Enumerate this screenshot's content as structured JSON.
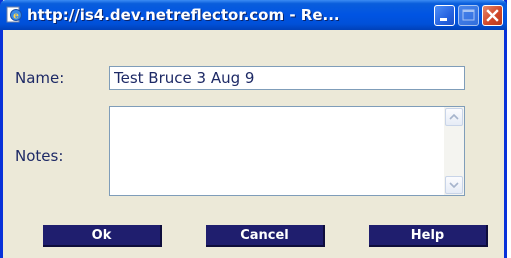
{
  "window": {
    "title": "http://is4.dev.netreflector.com - Re...",
    "controls": {
      "minimize_icon": "minimize-icon",
      "maximize_icon": "maximize-icon",
      "close_icon": "close-icon"
    },
    "title_icon": "ie-page-icon"
  },
  "form": {
    "name_label": "Name:",
    "name_value": "Test Bruce 3 Aug 9",
    "notes_label": "Notes:",
    "notes_value": ""
  },
  "buttons": {
    "ok": "Ok",
    "cancel": "Cancel",
    "help": "Help"
  },
  "colors": {
    "titlebar": "#0054E3",
    "dialog_bg": "#ECE9D8",
    "label_text": "#1E2A66",
    "button_bg": "#1F1E6E",
    "button_text": "#FFFFFF",
    "close_button": "#D2482A"
  }
}
